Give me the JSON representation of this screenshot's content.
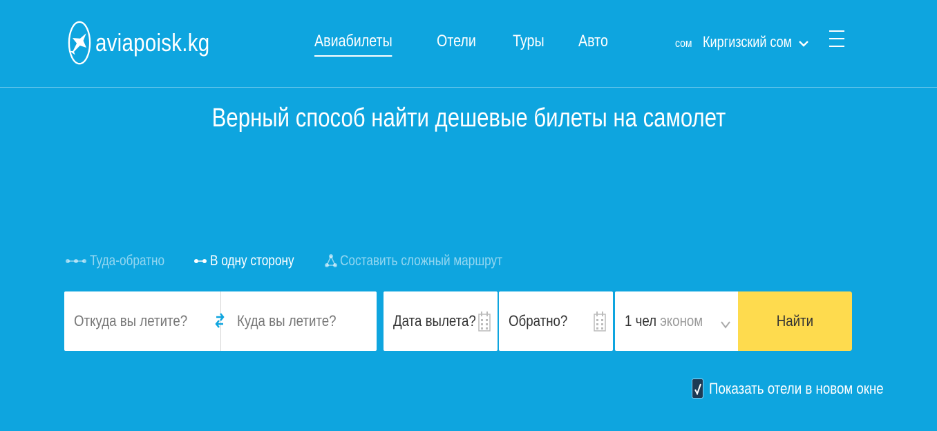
{
  "header": {
    "logo_text": "aviapoisk.kg",
    "nav": [
      "Авиабилеты",
      "Отели",
      "Туры",
      "Авто"
    ],
    "currency_code": "сом",
    "currency_name": "Киргизский сом"
  },
  "headline": "Верный способ найти дешевые билеты на самолет",
  "trip_types": [
    "Туда-обратно",
    "В одну сторону",
    "Составить сложный маршрут"
  ],
  "search": {
    "from_placeholder": "Откуда вы летите?",
    "to_placeholder": "Куда вы летите?",
    "depart_placeholder": "Дата вылета?",
    "return_placeholder": "Обратно?",
    "passengers": "1 чел",
    "cabin_class": "эконом",
    "submit_label": "Найти"
  },
  "show_hotels_label": "Показать отели в новом окне",
  "colors": {
    "background": "#0ea5df",
    "button": "#fedb4e"
  }
}
